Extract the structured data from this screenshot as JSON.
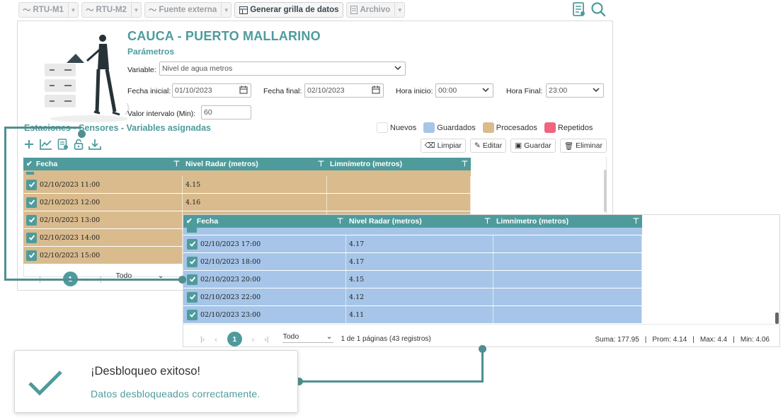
{
  "toolbar": {
    "items": [
      {
        "label": "RTU-M1"
      },
      {
        "label": "RTU-M2"
      },
      {
        "label": "Fuente externa"
      },
      {
        "label": "Generar grilla de datos"
      },
      {
        "label": "Archivo"
      }
    ]
  },
  "header": {
    "title": "CAUCA - PUERTO MALLARINO",
    "subtitle": "Parámetros"
  },
  "form": {
    "variable_label": "Variable:",
    "variable_value": "Nivel de agua metros",
    "fecha_inicial_label": "Fecha inicial:",
    "fecha_inicial_value": "01/10/2023",
    "fecha_final_label": "Fecha final:",
    "fecha_final_value": "02/10/2023",
    "hora_inicio_label": "Hora inicio:",
    "hora_inicio_value": "00:00",
    "hora_final_label": "Hora Final:",
    "hora_final_value": "23:00",
    "intervalo_label": "Valor intervalo (Min):",
    "intervalo_value": "60"
  },
  "section": {
    "title": "Estaciones - Sensores - Variables asignadas"
  },
  "legend": [
    {
      "label": "Nuevos",
      "color": "#ffffff"
    },
    {
      "label": "Guardados",
      "color": "#a6c5e8"
    },
    {
      "label": "Procesados",
      "color": "#d9bb8e"
    },
    {
      "label": "Repetidos",
      "color": "#f06480"
    }
  ],
  "actions": {
    "limpiar": "Limpiar",
    "editar": "Editar",
    "guardar": "Guardar",
    "eliminar": "Eliminar"
  },
  "grid": {
    "columns": [
      "Fecha",
      "Nivel Radar (metros)",
      "Limnímetro (metros)"
    ],
    "rows_main": [
      {
        "fecha": "02/10/2023 11:00",
        "radar": "4.15",
        "limni": ""
      },
      {
        "fecha": "02/10/2023 12:00",
        "radar": "4.16",
        "limni": ""
      },
      {
        "fecha": "02/10/2023 13:00",
        "radar": "",
        "limni": ""
      },
      {
        "fecha": "02/10/2023 14:00",
        "radar": "",
        "limni": ""
      },
      {
        "fecha": "02/10/2023 15:00",
        "radar": "",
        "limni": ""
      }
    ],
    "rows_zoom": [
      {
        "fecha": "02/10/2023 17:00",
        "radar": "4.17",
        "limni": ""
      },
      {
        "fecha": "02/10/2023 18:00",
        "radar": "4.17",
        "limni": ""
      },
      {
        "fecha": "02/10/2023 20:00",
        "radar": "4.15",
        "limni": ""
      },
      {
        "fecha": "02/10/2023 22:00",
        "radar": "4.12",
        "limni": ""
      },
      {
        "fecha": "02/10/2023 23:00",
        "radar": "4.11",
        "limni": ""
      }
    ],
    "colors": {
      "guardado": "#a6c5e8",
      "procesado": "#d9bb8e",
      "accent": "#4f9b9c"
    }
  },
  "pager": {
    "page": "1",
    "size_option": "Todo",
    "info": "1 de 1 páginas (43 registros)",
    "suma": "Suma: 177.95",
    "prom": "Prom: 4.14",
    "max": "Max: 4.4",
    "min": "Min: 4.06"
  },
  "toast": {
    "title": "¡Desbloqueo exitoso!",
    "message": "Datos desbloqueados correctamente."
  }
}
